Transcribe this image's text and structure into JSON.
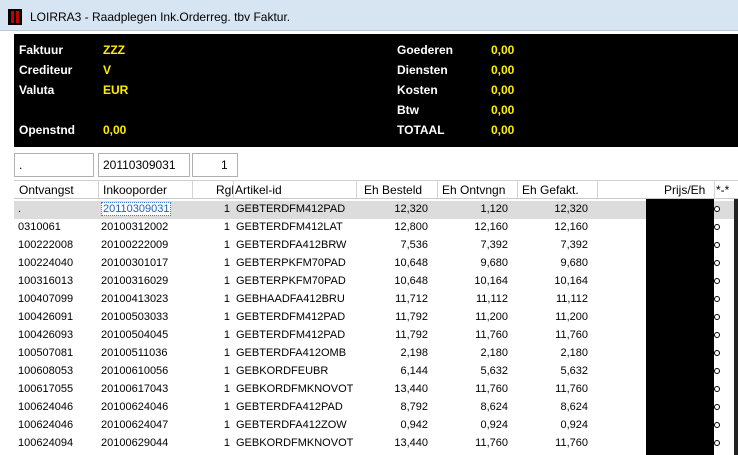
{
  "window": {
    "title": "LOIRRA3 - Raadplegen Ink.Orderreg. tbv Faktur."
  },
  "info": {
    "faktuur_label": "Faktuur",
    "faktuur_value": "ZZZ",
    "crediteur_label": "Crediteur",
    "crediteur_value": "V",
    "valuta_label": "Valuta",
    "valuta_value": "EUR",
    "openstnd_label": "Openstnd",
    "openstnd_value": "0,00",
    "goederen_label": "Goederen",
    "goederen_value": "0,00",
    "diensten_label": "Diensten",
    "diensten_value": "0,00",
    "kosten_label": "Kosten",
    "kosten_value": "0,00",
    "btw_label": "Btw",
    "btw_value": "0,00",
    "totaal_label": "TOTAAL",
    "totaal_value": "0,00"
  },
  "filters": {
    "ontvangst": ".",
    "inkooporder": "20110309031",
    "rgl": "1"
  },
  "grid": {
    "headers": {
      "ontvangst": "Ontvangst",
      "inkooporder": "Inkooporder",
      "rgl": "Rgl",
      "artikel": "Artikel-id",
      "besteld": "Eh Besteld",
      "ontvngn": "Eh Ontvngn",
      "gefakt": "Eh Gefakt.",
      "prijs": "Prijs/Eh",
      "star": "*-*"
    },
    "rows": [
      {
        "ontvangst": ".",
        "inkooporder": "20110309031",
        "rgl": "1",
        "artikel": "GEBTERDFM412PAD",
        "besteld": "12,320",
        "ontvngn": "1,120",
        "gefakt": "12,320"
      },
      {
        "ontvangst": "0310061",
        "inkooporder": "20100312002",
        "rgl": "1",
        "artikel": "GEBTERDFM412LAT",
        "besteld": "12,800",
        "ontvngn": "12,160",
        "gefakt": "12,160"
      },
      {
        "ontvangst": "100222008",
        "inkooporder": "20100222009",
        "rgl": "1",
        "artikel": "GEBTERDFA412BRW",
        "besteld": "7,536",
        "ontvngn": "7,392",
        "gefakt": "7,392"
      },
      {
        "ontvangst": "100224040",
        "inkooporder": "20100301017",
        "rgl": "1",
        "artikel": "GEBTERPKFM70PAD",
        "besteld": "10,648",
        "ontvngn": "9,680",
        "gefakt": "9,680"
      },
      {
        "ontvangst": "100316013",
        "inkooporder": "20100316029",
        "rgl": "1",
        "artikel": "GEBTERPKFM70PAD",
        "besteld": "10,648",
        "ontvngn": "10,164",
        "gefakt": "10,164"
      },
      {
        "ontvangst": "100407099",
        "inkooporder": "20100413023",
        "rgl": "1",
        "artikel": "GEBHAADFA412BRU",
        "besteld": "11,712",
        "ontvngn": "11,112",
        "gefakt": "11,112"
      },
      {
        "ontvangst": "100426091",
        "inkooporder": "20100503033",
        "rgl": "1",
        "artikel": "GEBTERDFM412PAD",
        "besteld": "11,792",
        "ontvngn": "11,200",
        "gefakt": "11,200"
      },
      {
        "ontvangst": "100426093",
        "inkooporder": "20100504045",
        "rgl": "1",
        "artikel": "GEBTERDFM412PAD",
        "besteld": "11,792",
        "ontvngn": "11,760",
        "gefakt": "11,760"
      },
      {
        "ontvangst": "100507081",
        "inkooporder": "20100511036",
        "rgl": "1",
        "artikel": "GEBTERDFA412OMB",
        "besteld": "2,198",
        "ontvngn": "2,180",
        "gefakt": "2,180"
      },
      {
        "ontvangst": "100608053",
        "inkooporder": "20100610056",
        "rgl": "1",
        "artikel": "GEBKORDFEUBR",
        "besteld": "6,144",
        "ontvngn": "5,632",
        "gefakt": "5,632"
      },
      {
        "ontvangst": "100617055",
        "inkooporder": "20100617043",
        "rgl": "1",
        "artikel": "GEBKORDFMKNOVOT",
        "besteld": "13,440",
        "ontvngn": "11,760",
        "gefakt": "11,760"
      },
      {
        "ontvangst": "100624046",
        "inkooporder": "20100624046",
        "rgl": "1",
        "artikel": "GEBTERDFA412PAD",
        "besteld": "8,792",
        "ontvngn": "8,624",
        "gefakt": "8,624"
      },
      {
        "ontvangst": "100624046",
        "inkooporder": "20100624047",
        "rgl": "1",
        "artikel": "GEBTERDFA412ZOW",
        "besteld": "0,942",
        "ontvngn": "0,924",
        "gefakt": "0,924"
      },
      {
        "ontvangst": "100624094",
        "inkooporder": "20100629044",
        "rgl": "1",
        "artikel": "GEBKORDFMKNOVOT",
        "besteld": "13,440",
        "ontvngn": "11,760",
        "gefakt": "11,760"
      }
    ]
  }
}
